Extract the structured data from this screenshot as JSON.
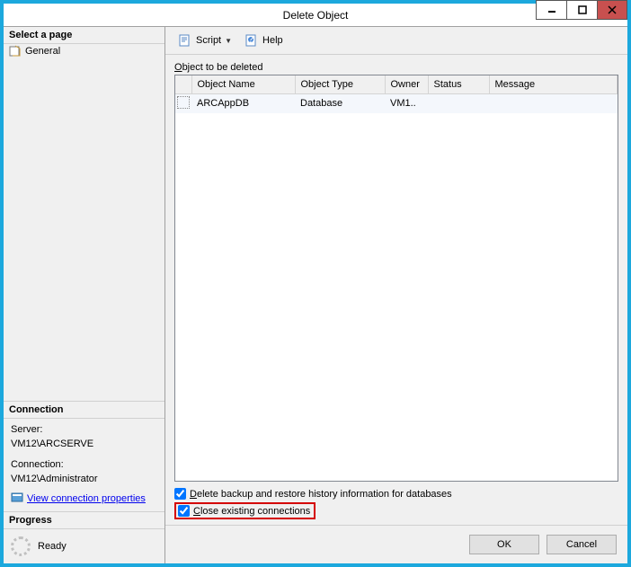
{
  "window": {
    "title": "Delete Object"
  },
  "left": {
    "select_page": "Select a page",
    "general": "General",
    "connection_header": "Connection",
    "server_label": "Server:",
    "server_value": "VM12\\ARCSERVE",
    "connection_label": "Connection:",
    "connection_value": "VM12\\Administrator",
    "view_props": "View connection properties",
    "progress_header": "Progress",
    "progress_status": "Ready"
  },
  "toolbar": {
    "script": "Script",
    "help": "Help"
  },
  "main": {
    "section_label_pre": "O",
    "section_label_post": "bject to be deleted",
    "headers": {
      "name": "Object Name",
      "type": "Object Type",
      "owner": "Owner",
      "status": "Status",
      "message": "Message"
    },
    "row": {
      "name": "ARCAppDB",
      "type": "Database",
      "owner": "VM1..",
      "status": "",
      "message": ""
    },
    "check1_pre": "D",
    "check1_post": "elete backup and restore history information for databases",
    "check2_pre": "C",
    "check2_post": "lose existing connections"
  },
  "buttons": {
    "ok": "OK",
    "cancel": "Cancel"
  }
}
